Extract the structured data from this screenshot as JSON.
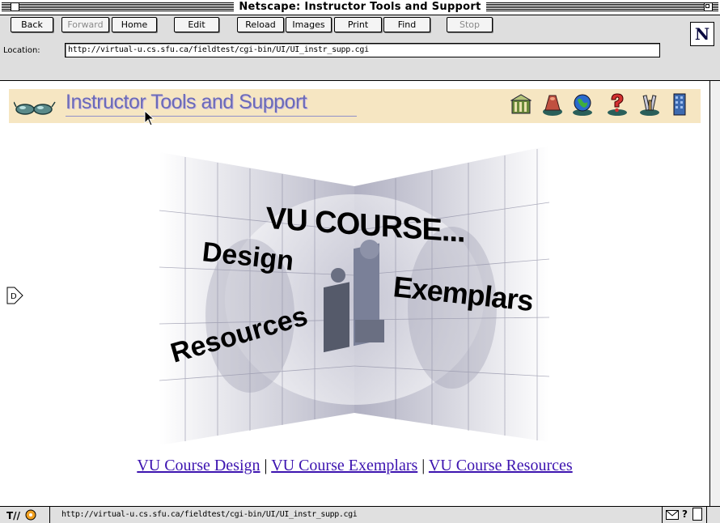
{
  "window": {
    "title": "Netscape: Instructor Tools and Support"
  },
  "toolbar": {
    "buttons": [
      {
        "label": "Back",
        "enabled": true
      },
      {
        "label": "Forward",
        "enabled": false
      },
      {
        "label": "Home",
        "enabled": true
      },
      {
        "label": "Edit",
        "enabled": true
      },
      {
        "label": "Reload",
        "enabled": true
      },
      {
        "label": "Images",
        "enabled": true
      },
      {
        "label": "Print",
        "enabled": true
      },
      {
        "label": "Find",
        "enabled": true
      },
      {
        "label": "Stop",
        "enabled": false
      }
    ],
    "logo_letter": "N",
    "location_label": "Location:",
    "location_value": "http://virtual-u.cs.sfu.ca/fieldtest/cgi-bin/UI/UI_instr_supp.cgi"
  },
  "banner": {
    "title": "Instructor Tools and Support",
    "left_icon": "eyeglasses-icon",
    "nav_icons": [
      "library-icon",
      "lab-icon",
      "globe-icon",
      "help-icon",
      "tools-icon",
      "building-icon"
    ]
  },
  "hero": {
    "headline": "VU COURSE...",
    "word_design": "Design",
    "word_exemplars": "Exemplars",
    "word_resources": "Resources"
  },
  "links": {
    "design": "VU Course Design",
    "exemplars": "VU Course Exemplars",
    "resources": "VU Course Resources",
    "separator": "|"
  },
  "statusbar": {
    "url": "http://virtual-u.cs.sfu.ca/fieldtest/cgi-bin/UI/UI_instr_supp.cgi",
    "secure_icon": "broken-key-icon",
    "mail_icon": "mail-icon",
    "help_icon": "question-icon"
  },
  "colors": {
    "banner_bg": "#f6e6c2",
    "link": "#3d14b0",
    "banner_text": "#6a6ab8",
    "toolbar_bg": "#dedede"
  }
}
